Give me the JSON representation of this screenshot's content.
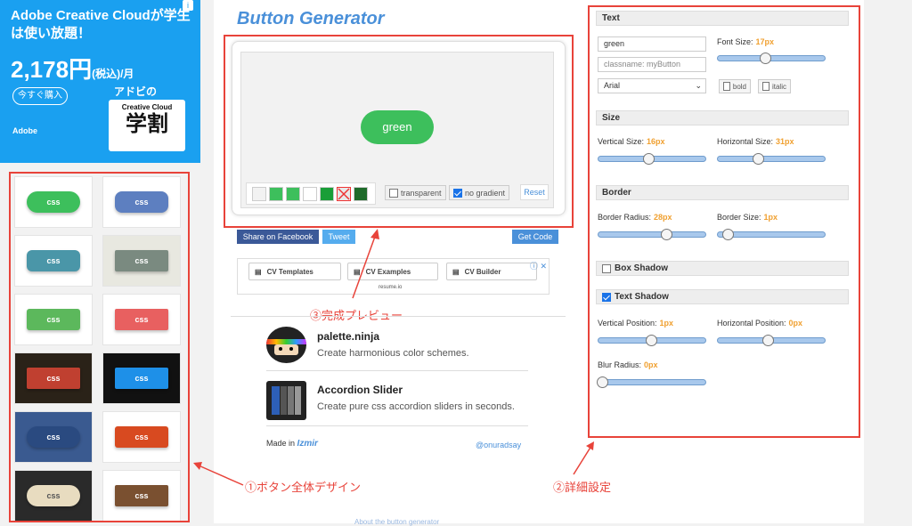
{
  "ad": {
    "headline": "Adobe Creative Cloudが学生は使い放題！",
    "price": "2,178円",
    "price_tax": "(税込)",
    "price_unit": "/月",
    "buy_button": "今すぐ購入",
    "brand": "Adobe",
    "badge_top": "アドビの",
    "badge_cc": "Creative Cloud",
    "badge_main": "学割",
    "info": "i"
  },
  "gallery": {
    "label": "css",
    "items": [
      {
        "bg": "#3dbf5c",
        "radius": "14px"
      },
      {
        "bg": "#5d7fc0",
        "radius": "8px"
      },
      {
        "bg": "#4a96a8",
        "radius": "6px"
      },
      {
        "bg": "#7a8a80",
        "radius": "2px"
      },
      {
        "bg": "#5cb85c",
        "radius": "3px"
      },
      {
        "bg": "#e86060",
        "radius": "2px"
      },
      {
        "bg": "#c04030",
        "radius": "2px"
      },
      {
        "bg": "#1e90e8",
        "radius": "2px"
      },
      {
        "bg": "#2a4a80",
        "radius": "14px"
      },
      {
        "bg": "#d84a20",
        "radius": "3px"
      },
      {
        "bg": "#e8dcc0",
        "radius": "12px"
      },
      {
        "bg": "#7a5030",
        "radius": "2px"
      }
    ]
  },
  "center": {
    "title": "Button Generator",
    "preview_label": "green",
    "swatches": [
      "#f2f2f2",
      "#3dbf5c",
      "#3dbf5c",
      "#ffffff",
      "#1a9e38",
      "#e8e8e8",
      "#1e6b2a"
    ],
    "transparent_label": "transparent",
    "no_gradient_label": "no gradient",
    "reset_label": "Reset",
    "share_facebook": "Share on Facebook",
    "tweet": "Tweet",
    "get_code": "Get Code",
    "cv_templates": "CV Templates",
    "cv_examples": "CV Examples",
    "cv_builder": "CV Builder",
    "resume_brand": "resume.io",
    "annotation_preview": "③完成プレビュー",
    "promo1_title": "palette.ninja",
    "promo1_desc": "Create harmonious color schemes.",
    "promo2_title": "Accordion Slider",
    "promo2_desc": "Create pure css accordion sliders in seconds.",
    "made_in": "Made in",
    "made_in_brand": "Izmir",
    "author": "@onuradsay",
    "about": "About the button generator"
  },
  "settings": {
    "text_section": "Text",
    "text_value": "green",
    "classname_placeholder": "classname: myButton",
    "font_select": "Arial",
    "font_size_label": "Font Size:",
    "font_size_value": "17px",
    "font_size_level": 0.45,
    "bold_label": "bold",
    "italic_label": "italic",
    "size_section": "Size",
    "vsize_label": "Vertical Size:",
    "vsize_value": "16px",
    "vsize_level": 0.48,
    "hsize_label": "Horizontal Size:",
    "hsize_value": "31px",
    "hsize_level": 0.38,
    "border_section": "Border",
    "bradius_label": "Border Radius:",
    "bradius_value": "28px",
    "bradius_level": 0.66,
    "bsize_label": "Border Size:",
    "bsize_value": "1px",
    "bsize_level": 0.06,
    "box_shadow_section": "Box Shadow",
    "text_shadow_section": "Text Shadow",
    "vpos_label": "Vertical Position:",
    "vpos_value": "1px",
    "vpos_level": 0.5,
    "hpos_label": "Horizontal Position:",
    "hpos_value": "0px",
    "hpos_level": 0.48,
    "blur_label": "Blur Radius:",
    "blur_value": "0px",
    "blur_level": 0.0
  },
  "annotations": {
    "left": "①ボタン全体デザイン",
    "right": "②詳細設定"
  },
  "colors": {
    "annotation": "#e8433a",
    "accent": "#4a90d9",
    "button_green": "#3dbf5c"
  }
}
